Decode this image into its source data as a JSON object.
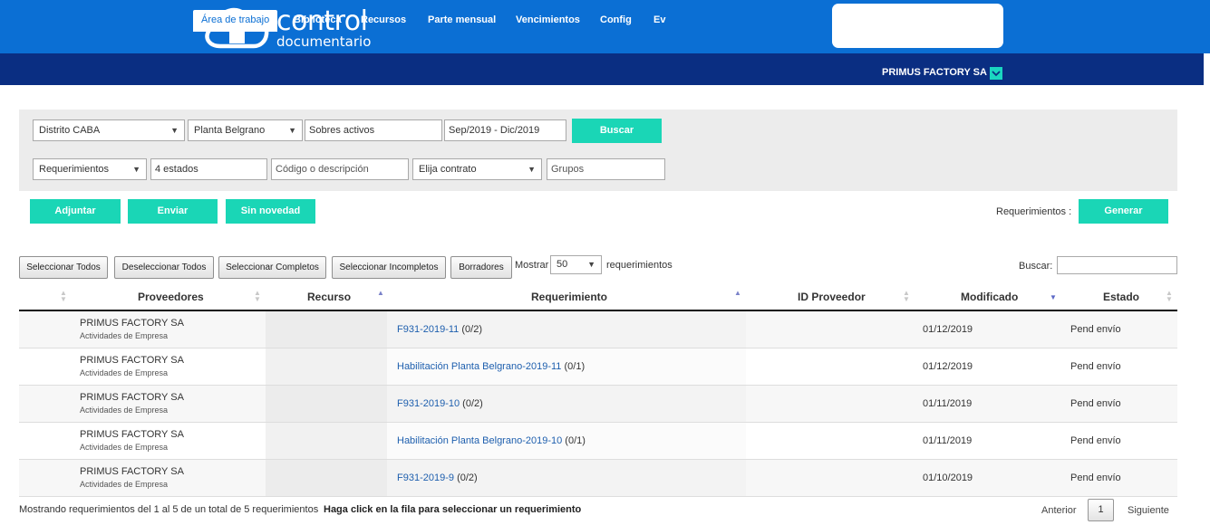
{
  "logo": {
    "main": "control",
    "sub": "documentario"
  },
  "nav": {
    "items": [
      "Área de trabajo",
      "Biblioteca",
      "Recursos",
      "Parte mensual",
      "Vencimientos",
      "Config",
      "Ev"
    ],
    "company": "PRIMUS FACTORY SA"
  },
  "filters": {
    "distrito": "Distrito CABA",
    "planta": "Planta Belgrano",
    "sobres": "Sobres activos",
    "periodo": "Sep/2019 - Dic/2019",
    "buscar_btn": "Buscar",
    "tipo": "Requerimientos",
    "estados": "4 estados",
    "codigo_placeholder": "Código o descripción",
    "contrato": "Elija contrato",
    "grupos_placeholder": "Grupos"
  },
  "actions": {
    "adjuntar": "Adjuntar",
    "enviar": "Enviar",
    "sin_novedad": "Sin novedad",
    "req_label": "Requerimientos :",
    "generar": "Generar"
  },
  "table_controls": {
    "seleccionar_todos": "Seleccionar Todos",
    "deseleccionar_todos": "Deseleccionar Todos",
    "seleccionar_completos": "Seleccionar Completos",
    "seleccionar_incompletos": "Seleccionar Incompletos",
    "borradores": "Borradores",
    "mostrar": "Mostrar",
    "page_size": "50",
    "req_suffix": "requerimientos",
    "buscar": "Buscar:"
  },
  "table": {
    "headers": [
      "Proveedores",
      "Recurso",
      "Requerimiento",
      "ID Proveedor",
      "Modificado",
      "Estado"
    ],
    "rows": [
      {
        "prov": "PRIMUS FACTORY SA",
        "prov_sub": "Actividades de Empresa",
        "req": "F931-2019-11",
        "count": "(0/2)",
        "mod": "01/12/2019",
        "estado": "Pend envío"
      },
      {
        "prov": "PRIMUS FACTORY SA",
        "prov_sub": "Actividades de Empresa",
        "req": "Habilitación Planta Belgrano-2019-11",
        "count": "(0/1)",
        "mod": "01/12/2019",
        "estado": "Pend envío"
      },
      {
        "prov": "PRIMUS FACTORY SA",
        "prov_sub": "Actividades de Empresa",
        "req": "F931-2019-10",
        "count": "(0/2)",
        "mod": "01/11/2019",
        "estado": "Pend envío"
      },
      {
        "prov": "PRIMUS FACTORY SA",
        "prov_sub": "Actividades de Empresa",
        "req": "Habilitación Planta Belgrano-2019-10",
        "count": "(0/1)",
        "mod": "01/11/2019",
        "estado": "Pend envío"
      },
      {
        "prov": "PRIMUS FACTORY SA",
        "prov_sub": "Actividades de Empresa",
        "req": "F931-2019-9",
        "count": "(0/2)",
        "mod": "01/10/2019",
        "estado": "Pend envío"
      }
    ]
  },
  "footer": {
    "info": "Mostrando requerimientos del 1 al 5 de un total de 5 requerimientos",
    "hint": "Haga click en la fila para seleccionar un requerimiento",
    "prev": "Anterior",
    "page": "1",
    "next": "Siguiente"
  },
  "colors": {
    "brand_blue": "#0b6fd4",
    "nav_dark": "#0a2e82",
    "teal": "#1ad6b6",
    "link": "#1e5fae"
  }
}
